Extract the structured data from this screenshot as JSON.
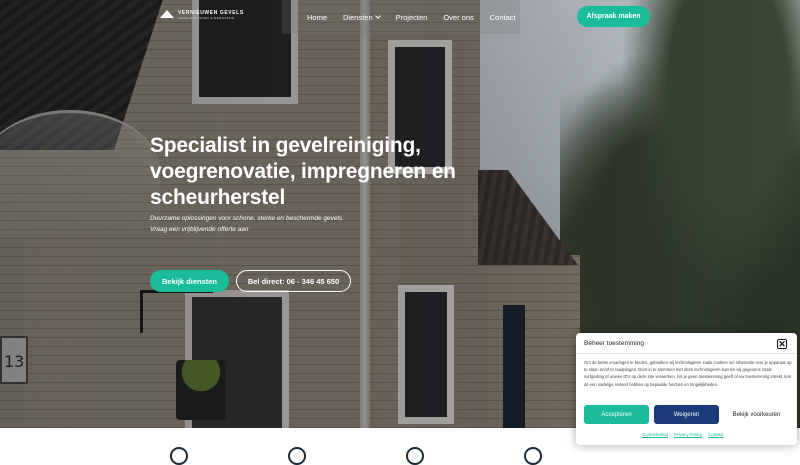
{
  "brand": {
    "name": "VERNIEUWEN GEVELS",
    "tagline": "GEVELREINIGING & RENOVATIE"
  },
  "nav": {
    "items": [
      "Home",
      "Diensten",
      "Projecten",
      "Over ons",
      "Contact"
    ],
    "cta": "Afspraak maken"
  },
  "hero": {
    "title": "Specialist in gevelreiniging, voegrenovatie, impregneren en scheurherstel",
    "subtitle_line1": "Duurzame oplossingen voor schone, sterke en beschermde gevels.",
    "subtitle_line2": "Vraag een vrijblijvende offerte aan",
    "primary_button": "Bekijk diensten",
    "secondary_button": "Bel direct: 06 - 346 45 650",
    "house_number": "13"
  },
  "cookie": {
    "title": "Beheer toestemming",
    "close": "✕",
    "body": "Om de beste ervaringen te bieden, gebruiken wij technologieën zoals cookies om informatie over je apparaat op te slaan en/of te raadplegen. Door in te stemmen met deze technologieën kunnen wij gegevens zoals surfgedrag of unieke ID's op deze site verwerken. Als je geen toestemming geeft of uw toestemming intrekt, kan dit een nadelige invloed hebben op bepaalde functies en mogelijkheden.",
    "accept": "Accepteren",
    "deny": "Weigeren",
    "preferences": "Bekijk voorkeuren",
    "links": [
      "Cookiebeleid",
      "Privacy Policy",
      "Contact"
    ]
  },
  "colors": {
    "accent": "#1abc9c",
    "deny": "#1a3a7a",
    "dark": "#1d2a38"
  }
}
